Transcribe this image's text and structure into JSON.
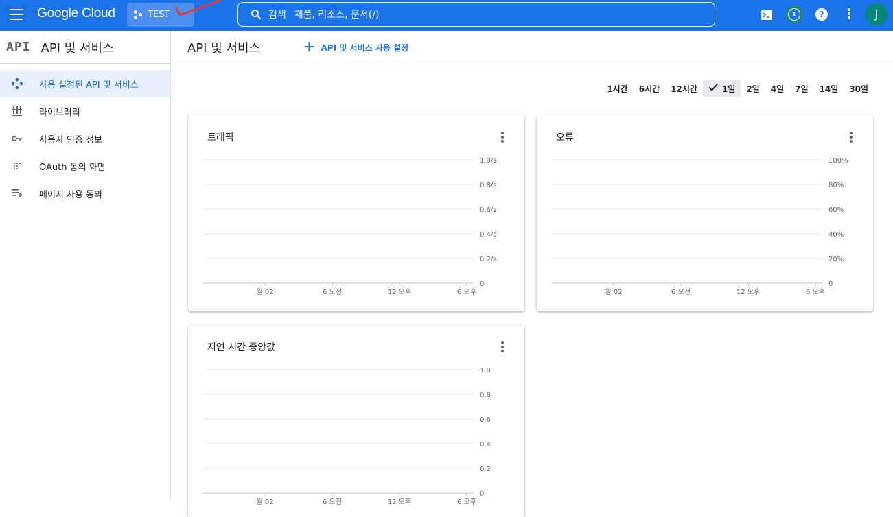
{
  "topbar": {
    "logo": "Google Cloud",
    "project": "TEST",
    "search_key": "검색",
    "search_placeholder": "제품, 리소스, 문서(/)",
    "notification_count": "1",
    "help": "?",
    "avatar": "J"
  },
  "sidebar": {
    "logo_text": "API",
    "title": "API 및 서비스",
    "items": [
      {
        "label": "사용 설정된 API 및 서비스",
        "icon": "diamond-api-icon"
      },
      {
        "label": "라이브러리",
        "icon": "library-icon"
      },
      {
        "label": "사용자 인증 정보",
        "icon": "key-icon"
      },
      {
        "label": "OAuth 동의 화면",
        "icon": "oauth-icon"
      },
      {
        "label": "페이지 사용 동의",
        "icon": "settings-list-icon"
      }
    ]
  },
  "main": {
    "title": "API 및 서비스",
    "enable_label": "API 및 서비스 사용 설정",
    "time_ranges": [
      "1시간",
      "6시간",
      "12시간",
      "1일",
      "2일",
      "4일",
      "7일",
      "14일",
      "30일"
    ],
    "selected_range": "1일"
  },
  "chart_data": [
    {
      "type": "line",
      "title": "트래픽",
      "x_ticks": [
        "월 02",
        "6 오전",
        "12 오후",
        "6 오후"
      ],
      "y_ticks": [
        "0",
        "0.2/s",
        "0.4/s",
        "0.6/s",
        "0.8/s",
        "1.0/s"
      ],
      "ylim": [
        0,
        1.0
      ],
      "series": []
    },
    {
      "type": "line",
      "title": "오류",
      "x_ticks": [
        "월 02",
        "6 오전",
        "12 오후",
        "6 오후"
      ],
      "y_ticks": [
        "0",
        "20%",
        "40%",
        "60%",
        "80%",
        "100%"
      ],
      "ylim": [
        0,
        100
      ],
      "series": []
    },
    {
      "type": "line",
      "title": "지연 시간 중앙값",
      "x_ticks": [
        "월 02",
        "6 오전",
        "12 오후",
        "6 오후"
      ],
      "y_ticks": [
        "0",
        "0.2",
        "0.4",
        "0.6",
        "0.8",
        "1.0"
      ],
      "ylim": [
        0,
        1.0
      ],
      "series": []
    }
  ]
}
